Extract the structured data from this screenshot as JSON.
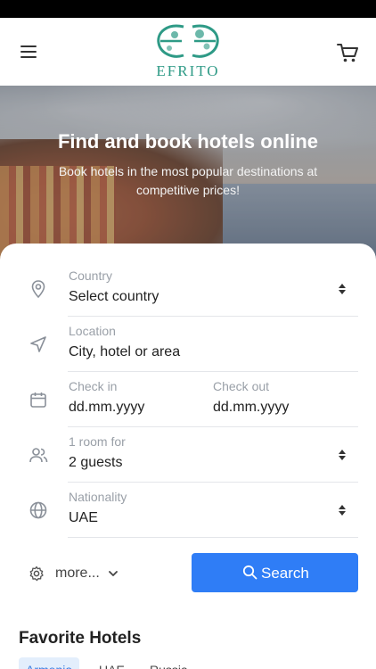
{
  "header": {
    "logo_text": "EFRITO",
    "menu_icon": "hamburger-menu-icon",
    "cart_icon": "shopping-cart-icon",
    "brand_color": "#2e9a86"
  },
  "hero": {
    "title": "Find and book hotels online",
    "subtitle": "Book hotels in the most popular destinations at competitive prices!"
  },
  "form": {
    "country": {
      "label": "Country",
      "value": "Select country",
      "icon": "map-pin-icon"
    },
    "location": {
      "label": "Location",
      "value": "City, hotel or area",
      "icon": "navigation-arrow-icon"
    },
    "dates": {
      "icon": "calendar-icon",
      "check_in_label": "Check in",
      "check_in_value": "dd.mm.yyyy",
      "check_out_label": "Check out",
      "check_out_value": "dd.mm.yyyy"
    },
    "guests": {
      "label": "1 room for",
      "value": "2 guests",
      "icon": "users-icon"
    },
    "nationality": {
      "label": "Nationality",
      "value": "UAE",
      "icon": "globe-icon"
    },
    "more_label": "more...",
    "search_label": "Search",
    "accent_color": "#2f7df6"
  },
  "favorites": {
    "title": "Favorite Hotels",
    "tabs": [
      {
        "label": "Armenia",
        "active": true
      },
      {
        "label": "UAE",
        "active": false
      },
      {
        "label": "Russia",
        "active": false
      }
    ]
  }
}
